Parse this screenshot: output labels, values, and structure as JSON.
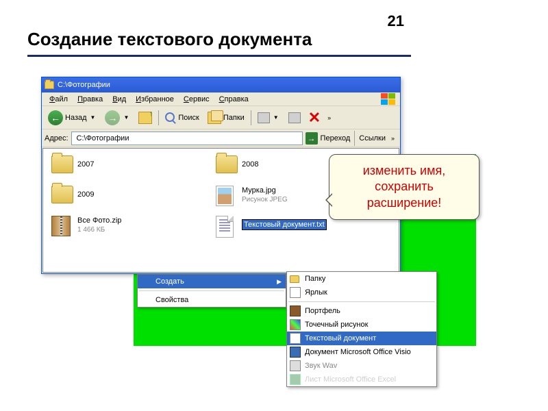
{
  "slide": {
    "number": "21",
    "title": "Создание текстового документа"
  },
  "window": {
    "title": "С:\\Фотографии",
    "menus": [
      "Файл",
      "Правка",
      "Вид",
      "Избранное",
      "Сервис",
      "Справка"
    ],
    "toolbar": {
      "back": "Назад",
      "search": "Поиск",
      "folders": "Папки",
      "more": "»"
    },
    "address": {
      "label": "Адрес:",
      "path": "С:\\Фотографии",
      "go": "Переход",
      "links": "Ссылки",
      "more": "»"
    },
    "files": [
      {
        "name": "2007",
        "type": "folder"
      },
      {
        "name": "2008",
        "type": "folder"
      },
      {
        "name": "2009",
        "type": "folder"
      },
      {
        "name": "Мурка.jpg",
        "sub": "Рисунок JPEG",
        "type": "jpg"
      },
      {
        "name": "Все Фото.zip",
        "sub": "1 466 КБ",
        "type": "zip"
      },
      {
        "name": "Текстовый документ.txt",
        "type": "txt",
        "editing": true
      }
    ]
  },
  "callout": {
    "line1": "изменить имя,",
    "line2": "сохранить",
    "line3": "расширение!"
  },
  "context_left": {
    "create": "Создать",
    "properties": "Свойства"
  },
  "context_right": [
    {
      "label": "Папку",
      "icon": "folder"
    },
    {
      "label": "Ярлык",
      "icon": "shortcut"
    },
    {
      "sep": true
    },
    {
      "label": "Портфель",
      "icon": "portf"
    },
    {
      "label": "Точечный рисунок",
      "icon": "bmp"
    },
    {
      "label": "Текстовый документ",
      "icon": "txt",
      "hl": true
    },
    {
      "label": "Документ Microsoft Office Visio",
      "icon": "visio"
    },
    {
      "label": "Звук Wav",
      "icon": "wav",
      "dim": true
    },
    {
      "label": "Лист Microsoft Office Excel",
      "icon": "xls",
      "dim": true,
      "cut": true
    }
  ]
}
